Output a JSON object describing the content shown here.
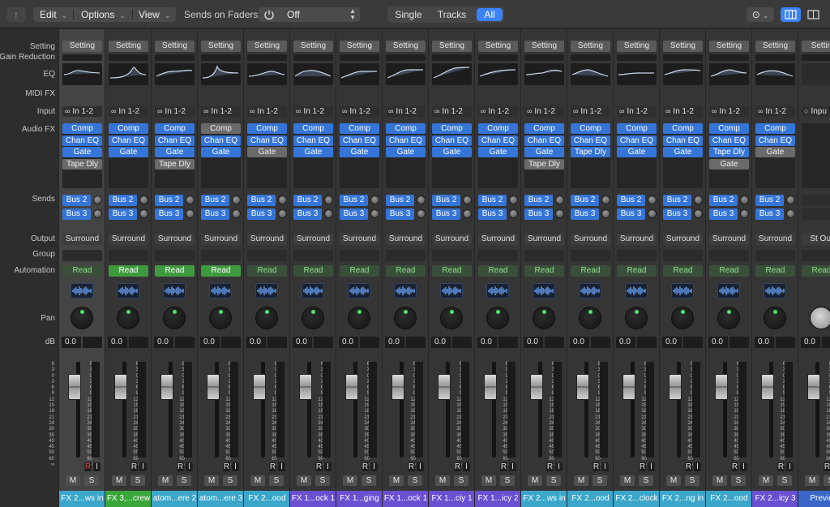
{
  "toolbar": {
    "edit": "Edit",
    "options": "Options",
    "view": "View",
    "sends_label": "Sends on Faders:",
    "sends_value": "Off",
    "segments": [
      "Single",
      "Tracks",
      "All"
    ],
    "active_segment": "All"
  },
  "row_labels": {
    "setting": "Setting",
    "gain_reduction": "Gain Reduction",
    "eq": "EQ",
    "midi_fx": "MIDI FX",
    "input": "Input",
    "audio_fx": "Audio FX",
    "sends": "Sends",
    "output": "Output",
    "group": "Group",
    "automation": "Automation",
    "pan": "Pan",
    "db": "dB"
  },
  "strips": [
    {
      "name": "FX 2...ws in",
      "color": "#3aa6c9",
      "input": "In 1-2",
      "fx": [
        "Comp",
        "Chan EQ",
        "Gate",
        "Tape Dly"
      ],
      "fx_off": [
        3
      ],
      "sends": [
        "Bus 2",
        "Bus 3"
      ],
      "output": "Surround",
      "automation": "Read",
      "auto_on": false,
      "db": "0.0",
      "setting": "Setting",
      "rec": true,
      "selected": true
    },
    {
      "name": "FX 3,...crew",
      "color": "#3aa63a",
      "input": "In 1-2",
      "fx": [
        "Comp",
        "Chan EQ",
        "Gate"
      ],
      "fx_off": [],
      "sends": [
        "Bus 2",
        "Bus 3"
      ],
      "output": "Surround",
      "automation": "Read",
      "auto_on": true,
      "db": "0.0",
      "setting": "Setting"
    },
    {
      "name": "atom...ere 2",
      "color": "#3aa6c9",
      "input": "In 1-2",
      "fx": [
        "Comp",
        "Chan EQ",
        "Gate",
        "Tape Dly"
      ],
      "fx_off": [
        3
      ],
      "sends": [
        "Bus 2",
        "Bus 3"
      ],
      "output": "Surround",
      "automation": "Read",
      "auto_on": true,
      "db": "0.0",
      "setting": "Setting"
    },
    {
      "name": "atom...ere 3",
      "color": "#3aa6c9",
      "input": "In 1-2",
      "fx": [
        "Comp",
        "Chan EQ",
        "Gate"
      ],
      "fx_off": [
        0
      ],
      "sends": [
        "Bus 2",
        "Bus 3"
      ],
      "output": "Surround",
      "automation": "Read",
      "auto_on": true,
      "db": "0.0",
      "setting": "Setting"
    },
    {
      "name": "FX 2...ood",
      "color": "#3aa6c9",
      "input": "In 1-2",
      "fx": [
        "Comp",
        "Chan EQ",
        "Gate"
      ],
      "fx_off": [
        2
      ],
      "sends": [
        "Bus 2",
        "Bus 3"
      ],
      "output": "Surround",
      "automation": "Read",
      "auto_on": false,
      "db": "0.0",
      "setting": "Setting"
    },
    {
      "name": "FX 1...ock 1",
      "color": "#6a4fd0",
      "input": "In 1-2",
      "fx": [
        "Comp",
        "Chan EQ",
        "Gate"
      ],
      "fx_off": [],
      "sends": [
        "Bus 2",
        "Bus 3"
      ],
      "output": "Surround",
      "automation": "Read",
      "auto_on": false,
      "db": "0.0",
      "setting": "Setting"
    },
    {
      "name": "FX 1...ging",
      "color": "#6a4fd0",
      "input": "In 1-2",
      "fx": [
        "Comp",
        "Chan EQ",
        "Gate"
      ],
      "fx_off": [],
      "sends": [
        "Bus 2",
        "Bus 3"
      ],
      "output": "Surround",
      "automation": "Read",
      "auto_on": false,
      "db": "0.0",
      "setting": "Setting"
    },
    {
      "name": "FX 1...ock 1",
      "color": "#6a4fd0",
      "input": "In 1-2",
      "fx": [
        "Comp",
        "Chan EQ",
        "Gate"
      ],
      "fx_off": [],
      "sends": [
        "Bus 2",
        "Bus 3"
      ],
      "output": "Surround",
      "automation": "Read",
      "auto_on": false,
      "db": "0.0",
      "setting": "Setting"
    },
    {
      "name": "FX 1...ciy 1",
      "color": "#6a4fd0",
      "input": "In 1-2",
      "fx": [
        "Comp",
        "Chan EQ",
        "Gate"
      ],
      "fx_off": [],
      "sends": [
        "Bus 2",
        "Bus 3"
      ],
      "output": "Surround",
      "automation": "Read",
      "auto_on": false,
      "db": "0.0",
      "setting": "Setting"
    },
    {
      "name": "FX 1...icy 2",
      "color": "#6a4fd0",
      "input": "In 1-2",
      "fx": [
        "Comp",
        "Chan EQ",
        "Gate"
      ],
      "fx_off": [],
      "sends": [
        "Bus 2",
        "Bus 3"
      ],
      "output": "Surround",
      "automation": "Read",
      "auto_on": false,
      "db": "0.0",
      "setting": "Setting"
    },
    {
      "name": "FX 2...ws in",
      "color": "#3aa6c9",
      "input": "In 1-2",
      "fx": [
        "Comp",
        "Chan EQ",
        "Gate",
        "Tape Dly"
      ],
      "fx_off": [
        3
      ],
      "sends": [
        "Bus 2",
        "Bus 3"
      ],
      "output": "Surround",
      "automation": "Read",
      "auto_on": false,
      "db": "0.0",
      "setting": "Setting"
    },
    {
      "name": "FX 2...ood",
      "color": "#3aa6c9",
      "input": "In 1-2",
      "fx": [
        "Comp",
        "Chan EQ",
        "Tape Dly"
      ],
      "fx_off": [],
      "sends": [
        "Bus 2",
        "Bus 3"
      ],
      "output": "Surround",
      "automation": "Read",
      "auto_on": false,
      "db": "0.0",
      "setting": "Setting"
    },
    {
      "name": "FX 2...clock",
      "color": "#3aa6c9",
      "input": "In 1-2",
      "fx": [
        "Comp",
        "Chan EQ",
        "Gate"
      ],
      "fx_off": [],
      "sends": [
        "Bus 2",
        "Bus 3"
      ],
      "output": "Surround",
      "automation": "Read",
      "auto_on": false,
      "db": "0.0",
      "setting": "Setting"
    },
    {
      "name": "FX 2...ng in",
      "color": "#3aa6c9",
      "input": "In 1-2",
      "fx": [
        "Comp",
        "Chan EQ",
        "Gate"
      ],
      "fx_off": [],
      "sends": [
        "Bus 2",
        "Bus 3"
      ],
      "output": "Surround",
      "automation": "Read",
      "auto_on": false,
      "db": "0.0",
      "setting": "Setting"
    },
    {
      "name": "FX 2...ood",
      "color": "#3aa6c9",
      "input": "In 1-2",
      "fx": [
        "Comp",
        "Chan EQ",
        "Tape Dly",
        "Gate"
      ],
      "fx_off": [
        3
      ],
      "sends": [
        "Bus 2",
        "Bus 3"
      ],
      "output": "Surround",
      "automation": "Read",
      "auto_on": false,
      "db": "0.0",
      "setting": "Setting"
    },
    {
      "name": "FX 2...icy 3",
      "color": "#6a4fd0",
      "input": "In 1-2",
      "fx": [
        "Comp",
        "Chan EQ",
        "Gate"
      ],
      "fx_off": [
        2
      ],
      "sends": [
        "Bus 2",
        "Bus 3"
      ],
      "output": "Surround",
      "automation": "Read",
      "auto_on": false,
      "db": "0.0",
      "setting": "Setting"
    },
    {
      "name": "Previe",
      "color": "#3a66c9",
      "input": "Inpu",
      "fx": [],
      "fx_off": [],
      "sends": [],
      "output": "St Out",
      "automation": "Read",
      "auto_on": false,
      "db": "0.0",
      "setting": "Settin",
      "preview": true
    }
  ],
  "meter_scale": [
    "6",
    "3",
    "0",
    "3",
    "6",
    "9",
    "12",
    "15",
    "18",
    "21",
    "24",
    "30",
    "35",
    "40",
    "45",
    "50",
    "60",
    "∞"
  ],
  "labels": {
    "mute": "M",
    "solo": "S",
    "rec": "R",
    "input_mon": "I"
  },
  "colors": {
    "accent": "#3b82f6",
    "fx_blue": "#3675d8",
    "read_green": "#3f9a3f"
  }
}
